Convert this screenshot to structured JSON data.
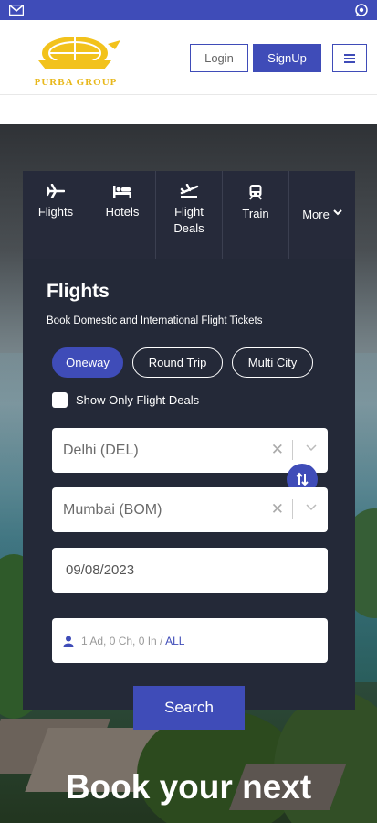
{
  "brand": {
    "name": "PURBA GROUP",
    "accent": "#3f4cb8",
    "logo_color": "#e8b81c"
  },
  "topbar": {
    "left_icon": "mail-icon",
    "right_icon": "whatsapp-icon"
  },
  "header": {
    "login_label": "Login",
    "signup_label": "SignUp",
    "menu_icon": "hamburger-icon"
  },
  "tabs": [
    {
      "label": "Flights",
      "icon": "plane-icon"
    },
    {
      "label": "Hotels",
      "icon": "bed-icon"
    },
    {
      "label": "Flight Deals",
      "icon": "plane-departure-icon"
    },
    {
      "label": "Train",
      "icon": "train-icon"
    },
    {
      "label": "More",
      "icon": "chevron-down-icon"
    }
  ],
  "search": {
    "title": "Flights",
    "subtitle": "Book Domestic and International Flight Tickets",
    "trip_types": [
      "Oneway",
      "Round Trip",
      "Multi City"
    ],
    "active_trip_type": "Oneway",
    "deals_checkbox_label": "Show Only Flight Deals",
    "from": "Delhi (DEL)",
    "to": "Mumbai (BOM)",
    "date": "09/08/2023",
    "passengers": "1 Ad, 0 Ch, 0 In /",
    "cabin_class": "ALL",
    "search_label": "Search"
  },
  "hero": {
    "headline": "Book your next"
  }
}
